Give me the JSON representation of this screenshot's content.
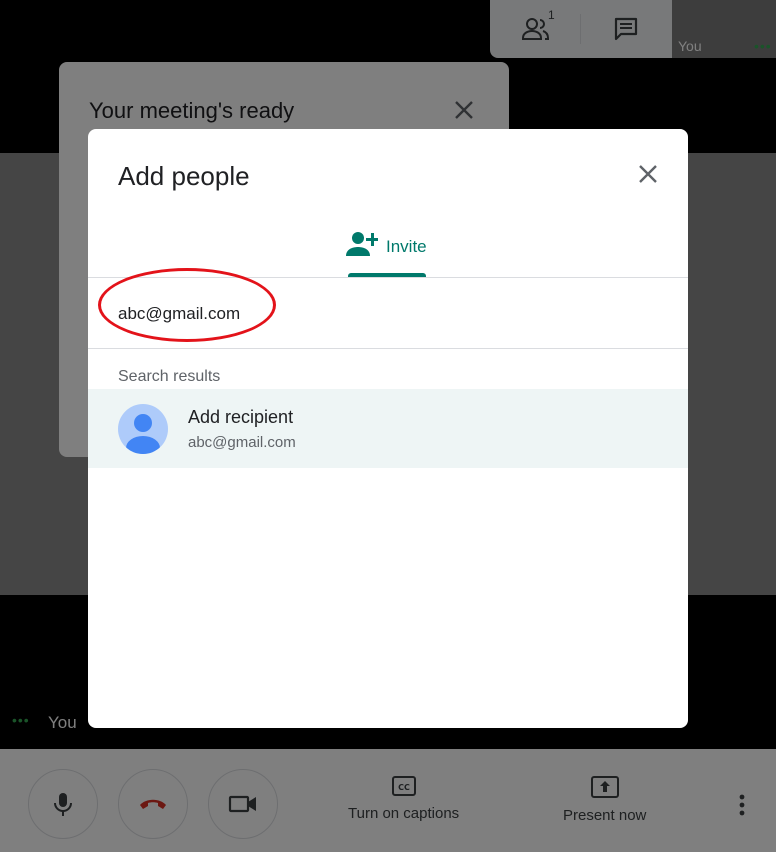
{
  "top_panel": {
    "participants_count": "1",
    "self_label": "You",
    "self_dots": "•••"
  },
  "ready_card": {
    "title": "Your meeting's ready"
  },
  "bottom_left": {
    "dots": "•••",
    "self_label": "You"
  },
  "dialog": {
    "title": "Add people",
    "tab_label": "Invite",
    "input_value": "abc@gmail.com",
    "results_label": "Search results",
    "result": {
      "name": "Add recipient",
      "email": "abc@gmail.com"
    }
  },
  "toolbar": {
    "captions_label": "Turn on captions",
    "present_label": "Present now"
  },
  "colors": {
    "accent": "#00796b",
    "hangup": "#d93025",
    "annotation": "#e3131a",
    "avatar_bg": "#aecbfa",
    "avatar_fg": "#4285f4",
    "status_green": "#34a853"
  }
}
